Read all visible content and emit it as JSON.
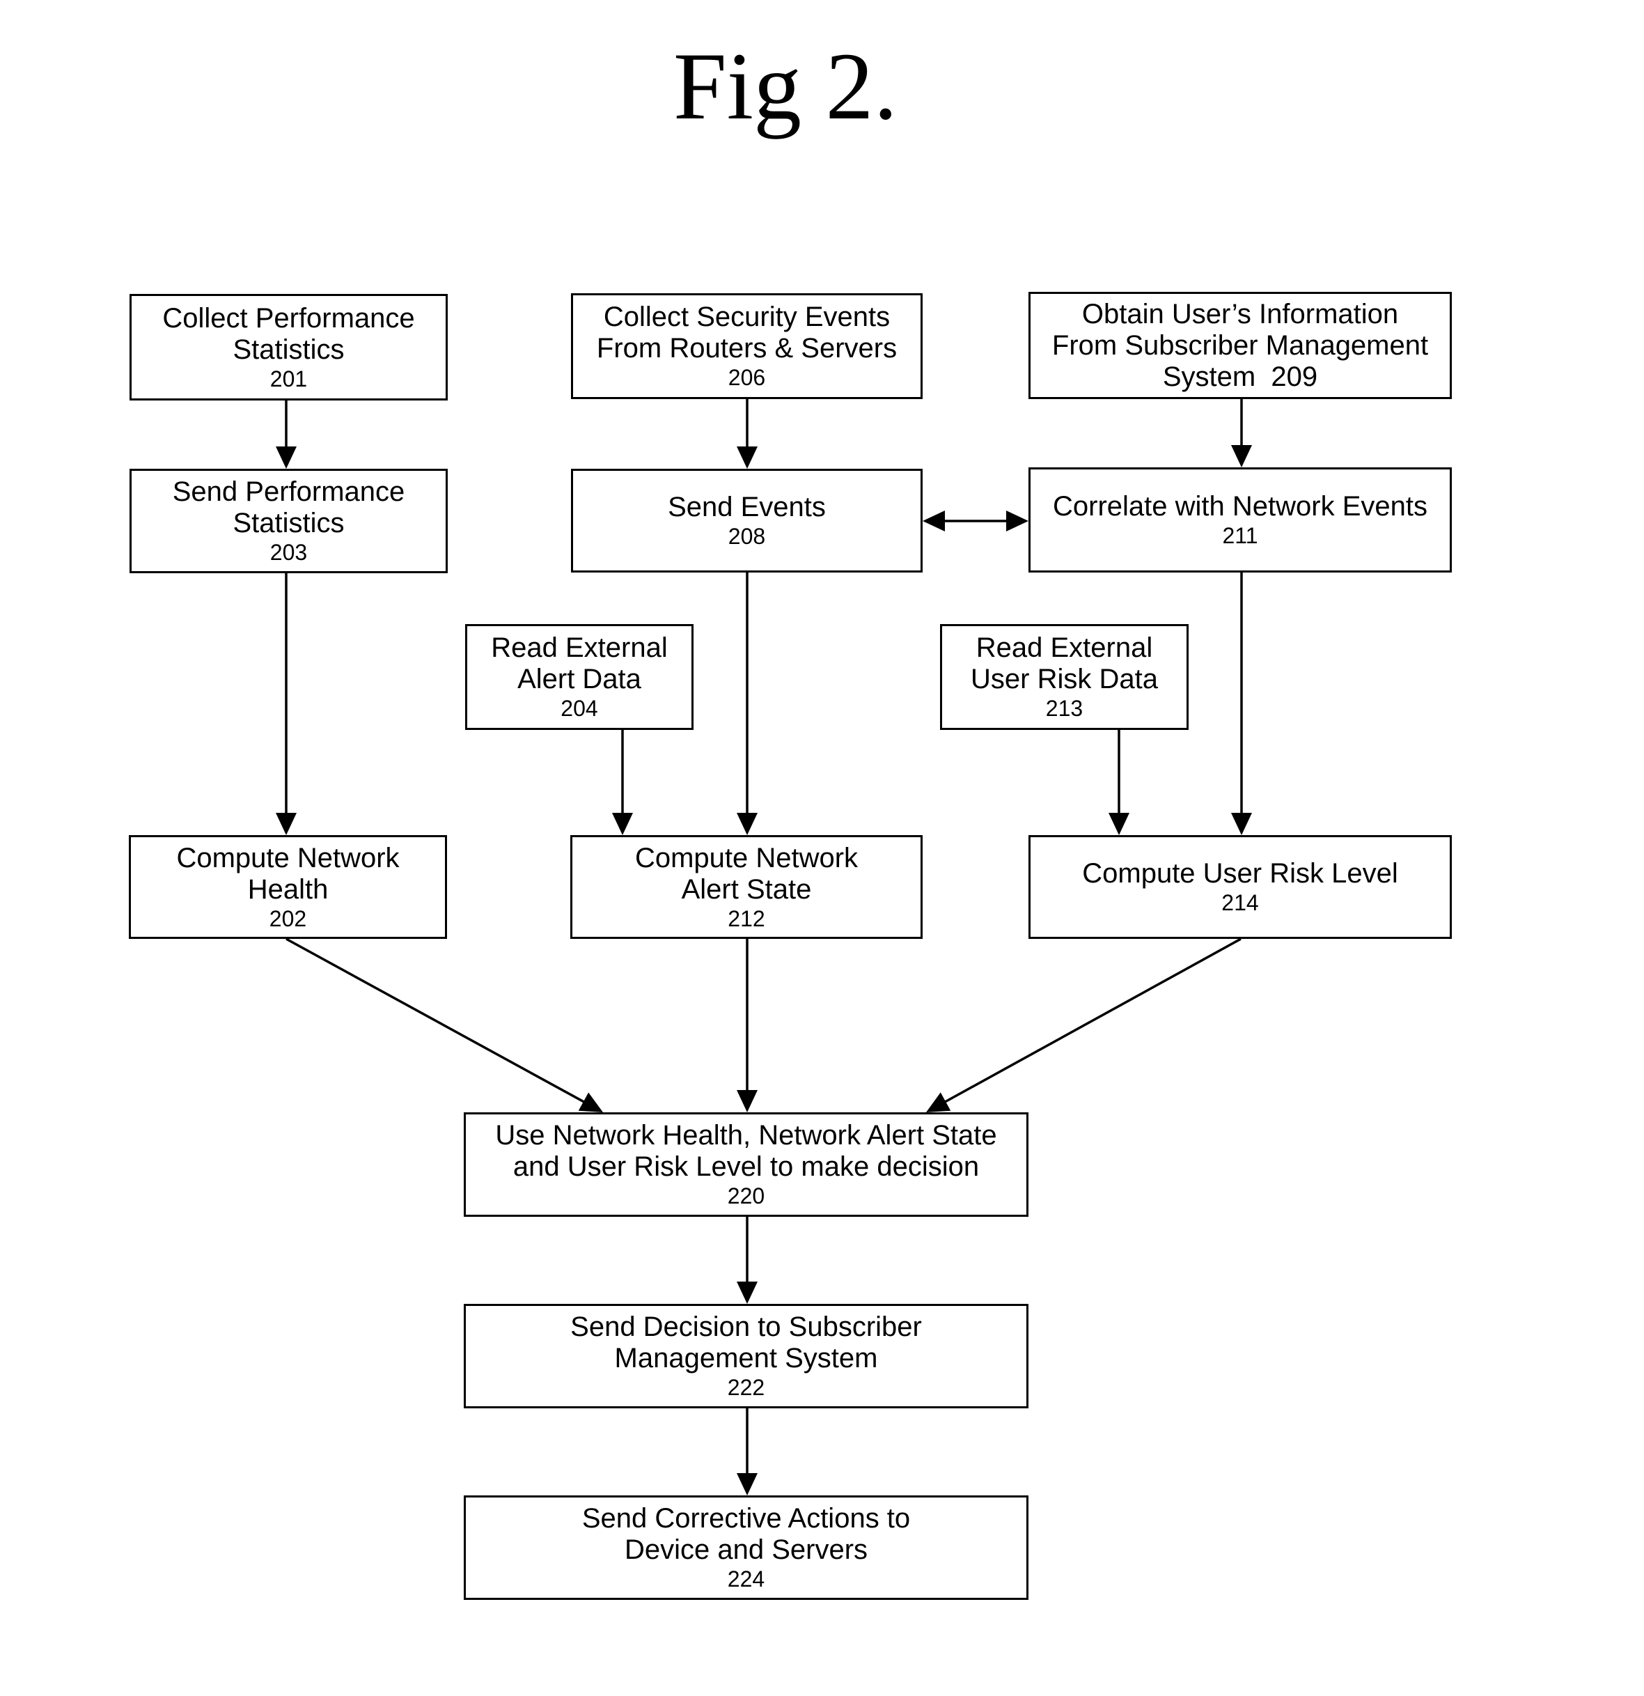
{
  "figure": {
    "title": "Fig 2."
  },
  "nodes": {
    "n201": {
      "lines": [
        "Collect Performance",
        "Statistics"
      ],
      "ref": "201"
    },
    "n203": {
      "lines": [
        "Send Performance",
        "Statistics"
      ],
      "ref": "203"
    },
    "n202": {
      "lines": [
        "Compute Network",
        "Health"
      ],
      "ref": "202"
    },
    "n206": {
      "lines": [
        "Collect Security Events",
        "From Routers & Servers"
      ],
      "ref": "206"
    },
    "n208": {
      "lines": [
        "Send Events"
      ],
      "ref": "208"
    },
    "n204": {
      "lines": [
        "Read External",
        "Alert Data"
      ],
      "ref": "204"
    },
    "n212": {
      "lines": [
        "Compute Network",
        "Alert State"
      ],
      "ref": "212"
    },
    "n209": {
      "lines": [
        "Obtain User’s Information",
        "From Subscriber Management"
      ],
      "last_line": "System  209",
      "ref": ""
    },
    "n211": {
      "lines": [
        "Correlate with Network Events"
      ],
      "ref": "211"
    },
    "n213": {
      "lines": [
        "Read External",
        "User Risk Data"
      ],
      "ref": "213"
    },
    "n214": {
      "lines": [
        "Compute User Risk Level"
      ],
      "ref": "214"
    },
    "n220": {
      "lines": [
        "Use Network Health, Network Alert State",
        "and User Risk Level to make decision"
      ],
      "ref": "220"
    },
    "n222": {
      "lines": [
        "Send Decision to Subscriber",
        "Management System"
      ],
      "ref": "222"
    },
    "n224": {
      "lines": [
        "Send Corrective Actions to",
        "Device and Servers"
      ],
      "ref": "224"
    }
  },
  "edges": [
    {
      "from": "201",
      "to": "203",
      "type": "arrow"
    },
    {
      "from": "203",
      "to": "202",
      "type": "arrow"
    },
    {
      "from": "206",
      "to": "208",
      "type": "arrow"
    },
    {
      "from": "208",
      "to": "212",
      "type": "arrow"
    },
    {
      "from": "204",
      "to": "212",
      "type": "arrow"
    },
    {
      "from": "209",
      "to": "211",
      "type": "arrow"
    },
    {
      "from": "208",
      "to": "211",
      "type": "bidirectional"
    },
    {
      "from": "211",
      "to": "214",
      "type": "arrow"
    },
    {
      "from": "213",
      "to": "214",
      "type": "arrow"
    },
    {
      "from": "202",
      "to": "220",
      "type": "arrow"
    },
    {
      "from": "212",
      "to": "220",
      "type": "arrow"
    },
    {
      "from": "214",
      "to": "220",
      "type": "arrow"
    },
    {
      "from": "220",
      "to": "222",
      "type": "arrow"
    },
    {
      "from": "222",
      "to": "224",
      "type": "arrow"
    }
  ]
}
